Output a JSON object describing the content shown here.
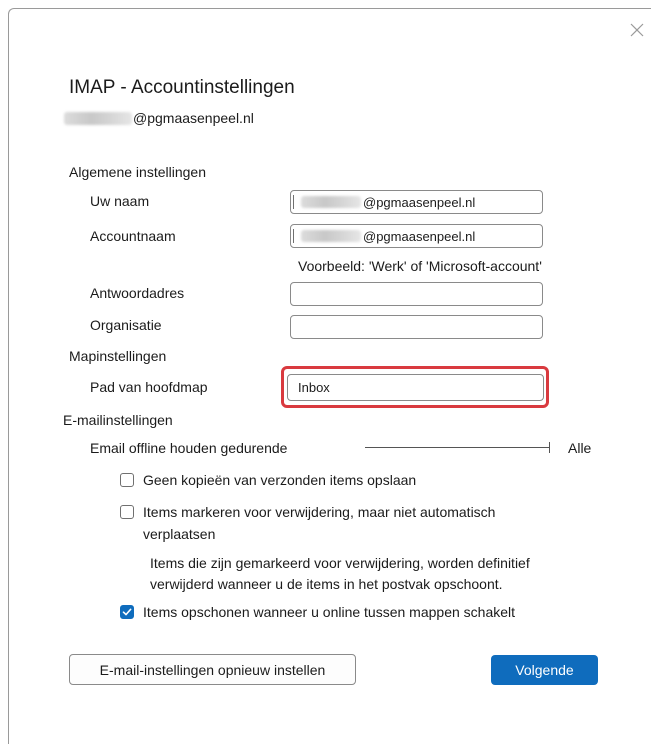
{
  "dialog": {
    "title": "IMAP - Accountinstellingen",
    "email_domain": "@pgmaasenpeel.nl"
  },
  "sections": {
    "general": "Algemene instellingen",
    "folder": "Mapinstellingen",
    "email": "E-mailinstellingen"
  },
  "fields": {
    "name_label": "Uw naam",
    "name_value_suffix": "@pgmaasenpeel.nl",
    "account_label": "Accountnaam",
    "account_value_suffix": "@pgmaasenpeel.nl",
    "account_hint": "Voorbeeld: 'Werk' of 'Microsoft-account'",
    "reply_label": "Antwoordadres",
    "reply_value": "",
    "org_label": "Organisatie",
    "org_value": "",
    "root_label": "Pad van hoofdmap",
    "root_value": "Inbox"
  },
  "offline": {
    "label": "Email offline houden gedurende",
    "value": "Alle"
  },
  "options": {
    "no_copies": {
      "label": "Geen kopieën van verzonden items opslaan",
      "checked": false
    },
    "mark_delete_line1": "Items markeren voor verwijdering, maar niet automatisch",
    "mark_delete_line2": "verplaatsen",
    "mark_delete_checked": false,
    "mark_delete_note_line1": "Items die zijn gemarkeerd voor verwijdering, worden definitief",
    "mark_delete_note_line2": "verwijderd wanneer u de items in het postvak opschoont.",
    "purge": {
      "label": "Items opschonen wanneer u online tussen mappen schakelt",
      "checked": true
    }
  },
  "buttons": {
    "reset": "E-mail-instellingen opnieuw instellen",
    "next": "Volgende"
  },
  "colors": {
    "accent": "#0f6cbd",
    "highlight": "#d93a3f"
  }
}
